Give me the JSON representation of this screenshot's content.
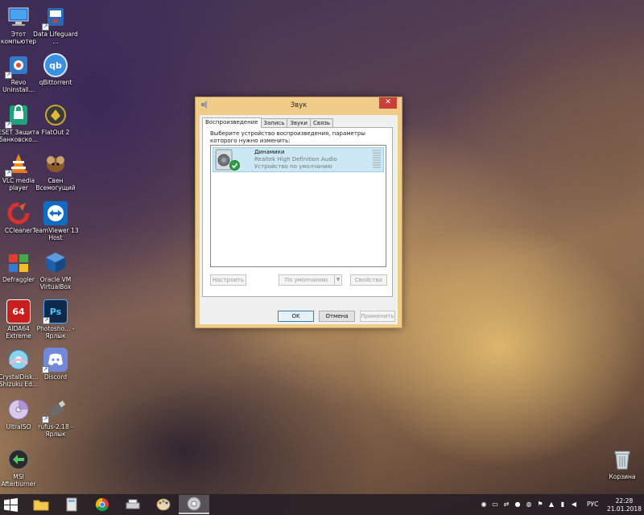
{
  "desktop": {
    "icons": [
      {
        "label": "Этот компьютер"
      },
      {
        "label": "Data Lifeguard ..."
      },
      {
        "label": "Revo Uninstall..."
      },
      {
        "label": "qBittorrent",
        "glyph": "qb"
      },
      {
        "label": "ESET Защита банковско..."
      },
      {
        "label": "FlatOut 2"
      },
      {
        "label": "VLC media player"
      },
      {
        "label": "Свен Всемогущий"
      },
      {
        "label": "CCleaner"
      },
      {
        "label": "TeamViewer 13 Host"
      },
      {
        "label": "Defraggler"
      },
      {
        "label": "Oracle VM VirtualBox"
      },
      {
        "label": "AIDA64 Extreme",
        "glyph": "64"
      },
      {
        "label": "Photosho... - Ярлык",
        "glyph": "Ps"
      },
      {
        "label": "CrystalDisk... Shizuku Ed..."
      },
      {
        "label": "Discord"
      },
      {
        "label": "UltraISO"
      },
      {
        "label": "rufus-2.18 - Ярлык"
      },
      {
        "label": "MSI Afterburner"
      },
      {
        "label": "Корзина"
      }
    ]
  },
  "dialog": {
    "title": "Звук",
    "close_glyph": "✕",
    "tabs": [
      "Воспроизведение",
      "Запись",
      "Звуки",
      "Связь"
    ],
    "instruction": "Выберите устройство воспроизведения, параметры которого нужно изменить:",
    "device": {
      "name": "Динамики",
      "driver": "Realtek High Definition Audio",
      "status": "Устройство по умолчанию"
    },
    "buttons": {
      "configure": "Настроить",
      "set_default": "По умолчанию",
      "properties": "Свойства",
      "ok": "OK",
      "cancel": "Отмена",
      "apply": "Применить"
    }
  },
  "taskbar": {
    "language": "РУС",
    "time": "22:28",
    "date": "21.01.2018"
  }
}
